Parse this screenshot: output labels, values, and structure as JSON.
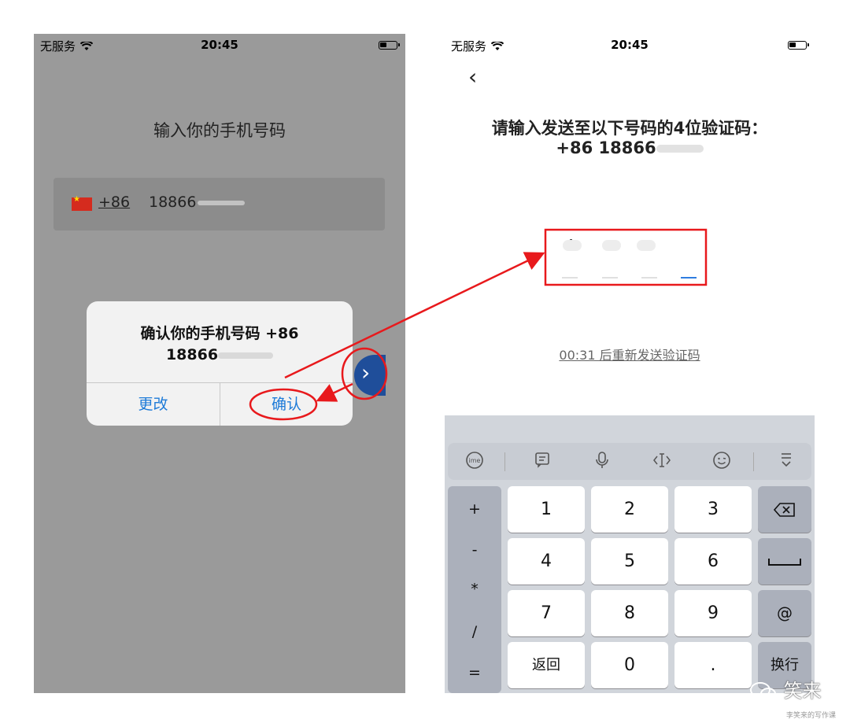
{
  "left_screen": {
    "status": {
      "carrier": "无服务",
      "time": "20:45"
    },
    "title": "输入你的手机号码",
    "country_code": "+86",
    "phone_number_visible": "18866",
    "next_icon": "chevron-right-icon",
    "dialog": {
      "message_line1": "确认你的手机号码 +86",
      "message_line2_visible": "18866",
      "change_label": "更改",
      "confirm_label": "确认"
    }
  },
  "right_screen": {
    "status": {
      "carrier": "无服务",
      "time": "20:45"
    },
    "back_icon": "chevron-left-icon",
    "title_line1": "请输入发送至以下号码的4位验证码：",
    "title_line2_visible": "+86 18866",
    "code_digits": [
      "4",
      "",
      "",
      ""
    ],
    "resend_text": "00:31 后重新发送验证码",
    "keyboard": {
      "toolbar_icons": [
        "ime-icon",
        "clipboard-icon",
        "microphone-icon",
        "cursor-icon",
        "emoji-icon",
        "collapse-keyboard-icon"
      ],
      "symbols": [
        "+",
        "-",
        "*",
        "/",
        "="
      ],
      "keys": [
        "1",
        "2",
        "3",
        "4",
        "5",
        "6",
        "7",
        "8",
        "9",
        "返回",
        "0",
        "."
      ],
      "backspace_icon": "backspace-icon",
      "space_icon": "space-icon",
      "at_label": "@",
      "enter_label": "换行"
    }
  },
  "watermark": {
    "logo_text": "笑来",
    "caption": "李笑来的写作课"
  },
  "annotation_color": "#e8191c"
}
